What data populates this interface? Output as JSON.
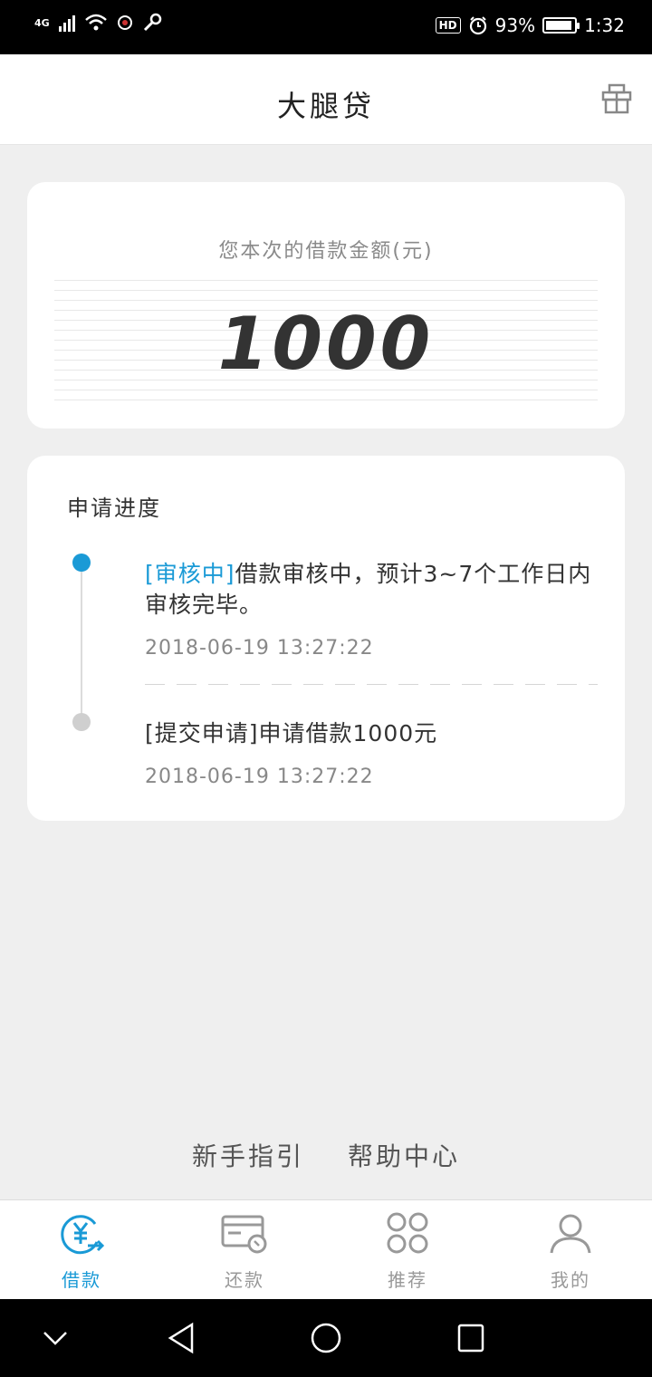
{
  "status_bar": {
    "network": "4G",
    "hd": "HD",
    "battery": "93%",
    "battery_level": 0.93,
    "time": "1:32"
  },
  "header": {
    "title": "大腿贷",
    "right_icon": "gift-icon"
  },
  "amount_card": {
    "label": "您本次的借款金额(元)",
    "value": "1000"
  },
  "progress": {
    "title": "申请进度",
    "entries": [
      {
        "status": "[审核中]",
        "message": "借款审核中，预计3~7个工作日内审核完毕。",
        "time": "2018-06-19  13:27:22",
        "active": true
      },
      {
        "status": "[提交申请]",
        "message": "申请借款1000元",
        "time": "2018-06-19  13:27:22",
        "active": false
      }
    ]
  },
  "footer_links": {
    "guide": "新手指引",
    "help": "帮助中心"
  },
  "tabs": [
    {
      "label": "借款",
      "icon": "loan-yen-icon",
      "active": true
    },
    {
      "label": "还款",
      "icon": "repay-card-icon",
      "active": false
    },
    {
      "label": "推荐",
      "icon": "recommend-grid-icon",
      "active": false
    },
    {
      "label": "我的",
      "icon": "profile-person-icon",
      "active": false
    }
  ],
  "colors": {
    "accent": "#1a9ad6",
    "background": "#efefef",
    "card": "#ffffff",
    "muted_text": "#888888"
  }
}
